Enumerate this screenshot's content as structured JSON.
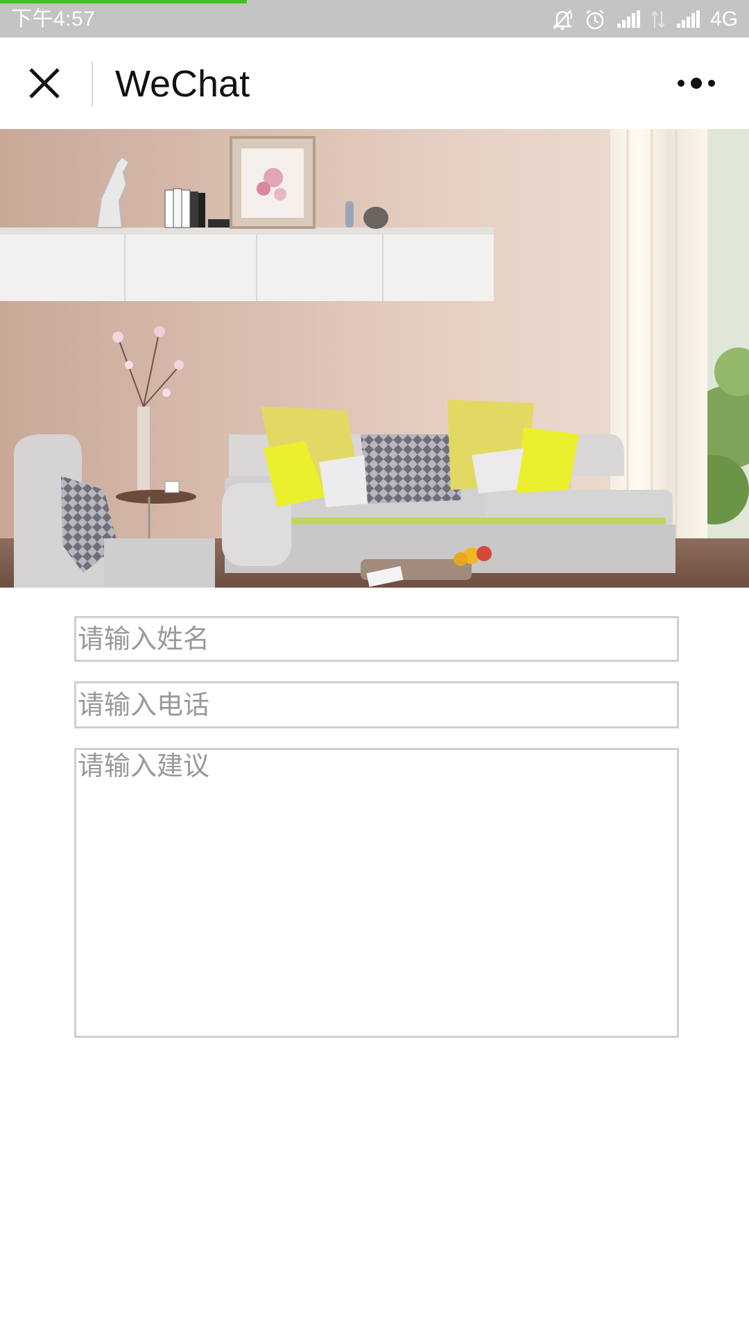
{
  "status_bar": {
    "time": "下午4:57",
    "network": "4G",
    "page_load_progress": 0.33,
    "icons": [
      "notifications-off-icon",
      "alarm-icon",
      "signal-icon",
      "data-arrows-icon",
      "signal-icon"
    ]
  },
  "nav": {
    "close_icon": "close-icon",
    "title": "WeChat",
    "more_icon": "more-dots-icon"
  },
  "banner": {
    "description_icon": "living-room-photo"
  },
  "form": {
    "name_placeholder": "请输入姓名",
    "phone_placeholder": "请输入电话",
    "advice_placeholder": "请输入建议"
  },
  "colors": {
    "status_bar_bg": "#c4c4c4",
    "progress": "#3fc21c",
    "field_border": "#cfcfcf",
    "placeholder": "#999999"
  }
}
